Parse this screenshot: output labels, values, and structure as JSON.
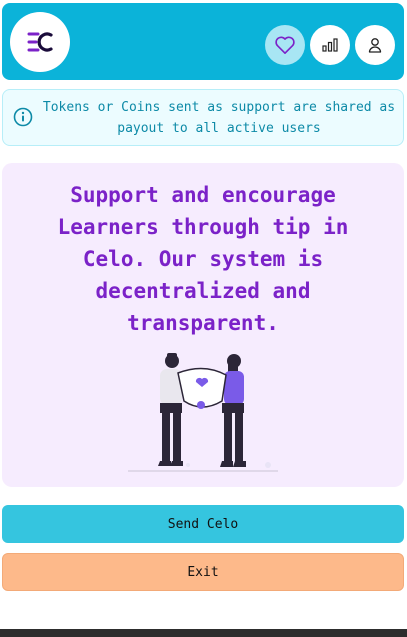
{
  "header": {
    "logo_text": "EC",
    "icons": [
      "heart-icon",
      "chart-icon",
      "user-icon"
    ]
  },
  "notice": {
    "text": "Tokens or Coins sent as support are shared as payout to all active users"
  },
  "card": {
    "headline": "Support and encourage Learners through tip in Celo. Our system is decentralized and transparent."
  },
  "buttons": {
    "send_label": "Send Celo",
    "exit_label": "Exit"
  },
  "colors": {
    "header_bg": "#0bb3d9",
    "accent_purple": "#7b22c8",
    "send_bg": "#35c5df",
    "exit_bg": "#fdb98a"
  }
}
